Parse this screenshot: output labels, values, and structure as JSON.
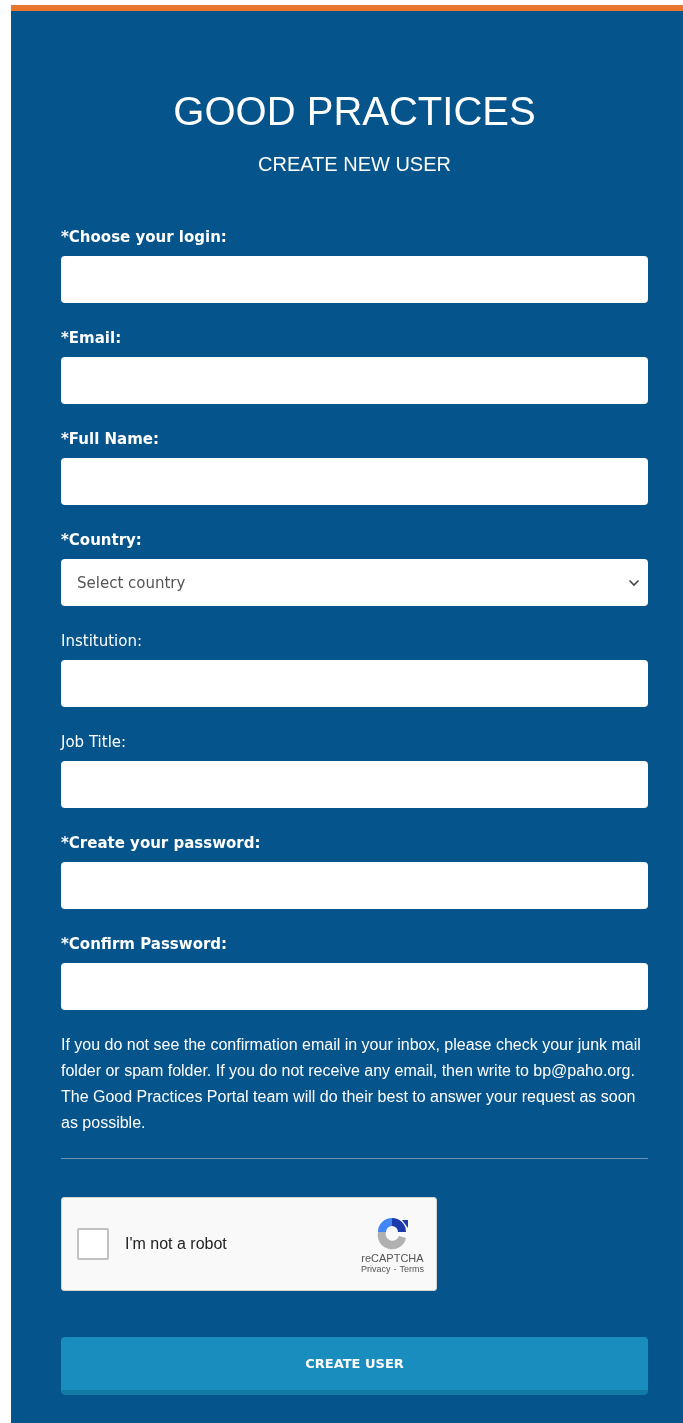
{
  "header": {
    "title": "GOOD PRACTICES",
    "subtitle": "CREATE NEW USER"
  },
  "fields": [
    {
      "kind": "text",
      "label": "*Choose your login:",
      "required": true
    },
    {
      "kind": "text",
      "label": "*Email:",
      "required": true
    },
    {
      "kind": "text",
      "label": "*Full Name:",
      "required": true
    },
    {
      "kind": "select",
      "label": "*Country:",
      "required": true,
      "placeholder": "Select country"
    },
    {
      "kind": "text",
      "label": "Institution:",
      "required": false
    },
    {
      "kind": "text",
      "label": "Job Title:",
      "required": false
    },
    {
      "kind": "password",
      "label": "*Create your password:",
      "required": true
    },
    {
      "kind": "password",
      "label": "*Confirm Password:",
      "required": true
    }
  ],
  "notice": "If you do not see the confirmation email in your inbox, please check your junk mail folder or spam folder. If you do not receive any email, then write to bp@paho.org. The Good Practices Portal team will do their best to answer your request as soon as possible.",
  "captcha": {
    "label": "I'm not a robot",
    "checked": false,
    "brand": "reCAPTCHA",
    "privacy": "Privacy",
    "separator": "-",
    "terms": "Terms"
  },
  "submit": "CREATE USER"
}
